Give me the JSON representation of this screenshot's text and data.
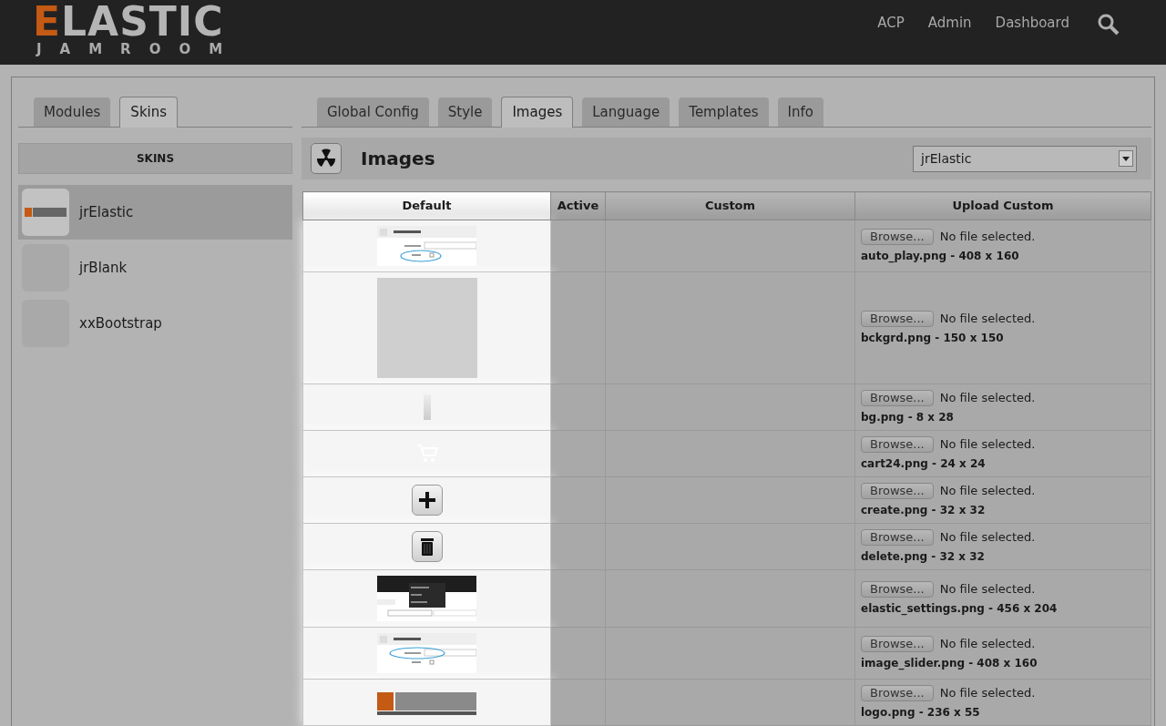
{
  "logo": {
    "initial": "E",
    "rest": "LASTIC",
    "sub": "JAMROOM"
  },
  "nav": [
    "ACP",
    "Admin",
    "Dashboard"
  ],
  "left_tabs": [
    {
      "label": "Modules",
      "selected": false
    },
    {
      "label": "Skins",
      "selected": true
    }
  ],
  "right_tabs": [
    {
      "label": "Global Config",
      "selected": false
    },
    {
      "label": "Style",
      "selected": false
    },
    {
      "label": "Images",
      "selected": true
    },
    {
      "label": "Language",
      "selected": false
    },
    {
      "label": "Templates",
      "selected": false
    },
    {
      "label": "Info",
      "selected": false
    }
  ],
  "sidebar": {
    "title": "SKINS",
    "items": [
      {
        "label": "jrElastic",
        "selected": true,
        "kind": "logo"
      },
      {
        "label": "jrBlank",
        "selected": false,
        "kind": "blank"
      },
      {
        "label": "xxBootstrap",
        "selected": false,
        "kind": "blank"
      }
    ]
  },
  "panel": {
    "title": "Images",
    "select": "jrElastic"
  },
  "table": {
    "columns": [
      "Default",
      "Active",
      "Custom",
      "Upload Custom"
    ],
    "rows": [
      {
        "kind": "autoplay",
        "button": "Browse...",
        "status": "No file selected.",
        "file": "auto_play.png - 408 x 160"
      },
      {
        "kind": "texture",
        "button": "Browse...",
        "status": "No file selected.",
        "file": "bckgrd.png - 150 x 150"
      },
      {
        "kind": "gradient",
        "button": "Browse...",
        "status": "No file selected.",
        "file": "bg.png - 8 x 28"
      },
      {
        "kind": "cart",
        "button": "Browse...",
        "status": "No file selected.",
        "file": "cart24.png - 24 x 24"
      },
      {
        "kind": "plus",
        "button": "Browse...",
        "status": "No file selected.",
        "file": "create.png - 32 x 32"
      },
      {
        "kind": "trash",
        "button": "Browse...",
        "status": "No file selected.",
        "file": "delete.png - 32 x 32"
      },
      {
        "kind": "menu",
        "button": "Browse...",
        "status": "No file selected.",
        "file": "elastic_settings.png - 456 x 204"
      },
      {
        "kind": "slider",
        "button": "Browse...",
        "status": "No file selected.",
        "file": "image_slider.png - 408 x 160"
      },
      {
        "kind": "logo",
        "button": "Browse...",
        "status": "No file selected.",
        "file": "logo.png - 236 x 55"
      }
    ]
  }
}
